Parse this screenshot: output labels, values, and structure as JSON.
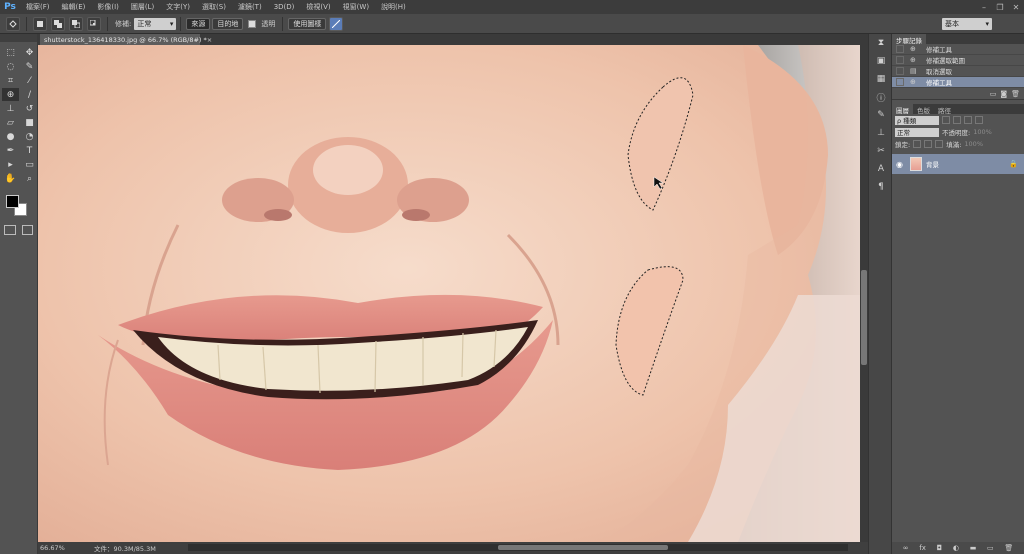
{
  "app": {
    "logo": "Ps",
    "window_controls": [
      "–",
      "❐",
      "✕"
    ]
  },
  "menu": [
    "檔案(F)",
    "編輯(E)",
    "影像(I)",
    "圖層(L)",
    "文字(Y)",
    "選取(S)",
    "濾鏡(T)",
    "3D(D)",
    "檢視(V)",
    "視窗(W)",
    "說明(H)"
  ],
  "options_bar": {
    "repair_label": "修補:",
    "mode_value": "正常",
    "source_button": "來源",
    "destination_button": "目的地",
    "transparent_label": "透明",
    "use_pattern_button": "使用圖樣",
    "workspace_value": "基本"
  },
  "document": {
    "tab_title": "shutterstock_136418330.jpg @ 66.7% (RGB/8#) *",
    "zoom": "66.67%",
    "doc_size": "文件：90.3M/85.3M"
  },
  "history": {
    "tabs": [
      "步驟記錄"
    ],
    "items": [
      {
        "icon": "patch-tool-icon",
        "label": "修補工具",
        "selected": false
      },
      {
        "icon": "patch-tool-icon",
        "label": "修補選取範圍",
        "selected": false
      },
      {
        "icon": "patch-tool-icon",
        "label": "取消選取",
        "selected": false
      },
      {
        "icon": "patch-tool-icon",
        "label": "修補工具",
        "selected": true
      }
    ]
  },
  "layers": {
    "tabs": [
      "圖層",
      "色版",
      "路徑"
    ],
    "filter_label": "ρ 種類",
    "blend_mode": "正常",
    "opacity_label": "不透明度:",
    "opacity_value": "100%",
    "lock_label": "鎖定:",
    "fill_label": "填滿:",
    "fill_value": "100%",
    "layer_name": "背景"
  }
}
